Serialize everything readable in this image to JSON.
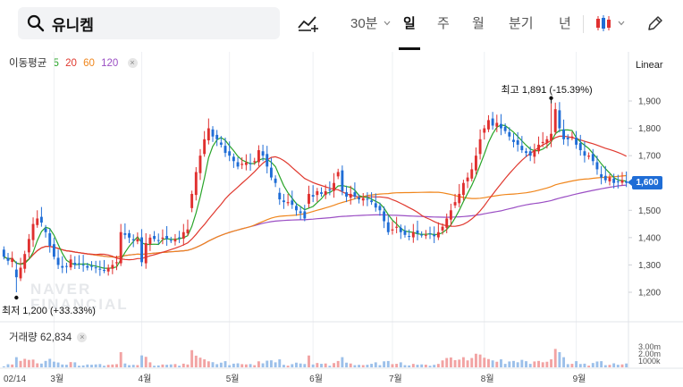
{
  "header": {
    "search_query": "유니켐",
    "period_tabs": [
      "30분",
      "일",
      "주",
      "월",
      "분기",
      "년"
    ],
    "active_tab": "일"
  },
  "icons": [
    "search-icon",
    "compare-chart-icon",
    "chevron-down-icon",
    "candlestick-icon",
    "pencil-icon"
  ],
  "legend": {
    "label": "이동평균",
    "ma": [
      {
        "period": "5",
        "color": "#2aa52a"
      },
      {
        "period": "20",
        "color": "#e0392f"
      },
      {
        "period": "60",
        "color": "#f0861c"
      },
      {
        "period": "120",
        "color": "#9b4fc4"
      }
    ],
    "volume_label": "거래량",
    "volume_value": "62,834"
  },
  "price_axis": {
    "scale_label": "Linear",
    "ticks": [
      "1,900",
      "1,800",
      "1,700",
      "1,600",
      "1,500",
      "1,400",
      "1,300",
      "1,200"
    ],
    "current_price": "1,600"
  },
  "volume_axis": {
    "ticks": [
      "3.00m",
      "2.00m",
      "1000k"
    ]
  },
  "time_axis": {
    "labels": [
      "02/14",
      "3월",
      "4월",
      "5월",
      "6월",
      "7월",
      "8월",
      "9월"
    ]
  },
  "annotations": {
    "high": "최고 1,891 (-15.39%)",
    "low": "최저 1,200 (+33.33%)"
  },
  "watermark": [
    "NAVER",
    "FINANCIAL"
  ],
  "colors": {
    "up": "#e0302f",
    "down": "#1f6dd6",
    "ma5": "#2aa52a",
    "ma20": "#e0392f",
    "ma60": "#f0861c",
    "ma120": "#9b4fc4",
    "current_price_tag": "#1f6dd6"
  },
  "chart_data": {
    "type": "candlestick",
    "price_scale": "linear",
    "ylim": [
      1170,
      1960
    ],
    "month_starts": [
      {
        "label": "02/14",
        "index": 0
      },
      {
        "label": "3월",
        "index": 12
      },
      {
        "label": "4월",
        "index": 33
      },
      {
        "label": "5월",
        "index": 54
      },
      {
        "label": "6월",
        "index": 74
      },
      {
        "label": "7월",
        "index": 93
      },
      {
        "label": "8월",
        "index": 115
      },
      {
        "label": "9월",
        "index": 137
      }
    ],
    "closes": [
      1330,
      1315,
      1325,
      1255,
      1290,
      1340,
      1395,
      1450,
      1470,
      1455,
      1420,
      1370,
      1330,
      1300,
      1290,
      1295,
      1320,
      1300,
      1305,
      1300,
      1290,
      1295,
      1290,
      1285,
      1280,
      1290,
      1300,
      1310,
      1420,
      1410,
      1400,
      1390,
      1395,
      1310,
      1380,
      1400,
      1395,
      1390,
      1400,
      1395,
      1390,
      1395,
      1400,
      1420,
      1430,
      1560,
      1640,
      1700,
      1760,
      1800,
      1770,
      1760,
      1740,
      1710,
      1700,
      1680,
      1660,
      1670,
      1675,
      1670,
      1680,
      1720,
      1700,
      1660,
      1620,
      1600,
      1540,
      1530,
      1530,
      1520,
      1500,
      1490,
      1470,
      1560,
      1550,
      1570,
      1560,
      1570,
      1575,
      1600,
      1640,
      1570,
      1550,
      1560,
      1550,
      1540,
      1545,
      1540,
      1530,
      1510,
      1500,
      1460,
      1420,
      1430,
      1440,
      1420,
      1410,
      1405,
      1420,
      1415,
      1410,
      1410,
      1415,
      1405,
      1420,
      1440,
      1470,
      1500,
      1530,
      1560,
      1600,
      1620,
      1650,
      1700,
      1760,
      1800,
      1830,
      1810,
      1820,
      1800,
      1790,
      1770,
      1750,
      1740,
      1720,
      1710,
      1700,
      1720,
      1740,
      1750,
      1760,
      1780,
      1870,
      1800,
      1760,
      1760,
      1770,
      1740,
      1720,
      1700,
      1700,
      1680,
      1650,
      1620,
      1610,
      1620,
      1600,
      1605,
      1610,
      1600
    ]
  }
}
